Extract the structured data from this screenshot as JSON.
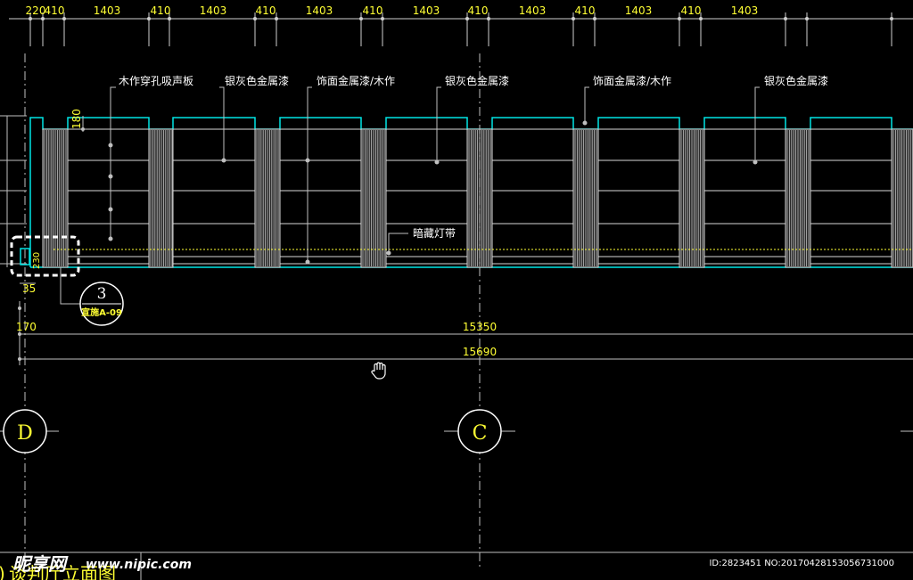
{
  "drawing": {
    "top_dimensions": [
      "220",
      "410",
      "1403",
      "410",
      "1403",
      "410",
      "1403",
      "410",
      "1403",
      "410",
      "1403",
      "410",
      "1403",
      "410",
      "1403"
    ],
    "callouts": [
      "木作穿孔吸声板",
      "银灰色金属漆",
      "饰面金属漆/木作",
      "银灰色金属漆",
      "饰面金属漆/木作",
      "银灰色金属漆"
    ],
    "light_strip_label": "暗藏灯带",
    "vertical_dims": {
      "top": "180",
      "bottom": "230"
    },
    "small_dims": {
      "d35": "35",
      "d170": "170"
    },
    "overall_dims": {
      "inner": "15350",
      "outer": "15690"
    },
    "detail_marker": {
      "number": "3",
      "sheet": "宣施A-09"
    },
    "grid_axes": [
      "D",
      "C"
    ],
    "title_partial": "谈判厅立面图",
    "title_prefix": ")",
    "colors": {
      "background": "#000000",
      "outline": "#00e5e5",
      "annotation": "#ffff33",
      "lines": "#ffffff",
      "selection": "#ffffff"
    }
  },
  "watermark": {
    "brand": "昵享网",
    "url": "www.nipic.com",
    "image_id": "ID:2823451 NO:20170428153056731000"
  }
}
